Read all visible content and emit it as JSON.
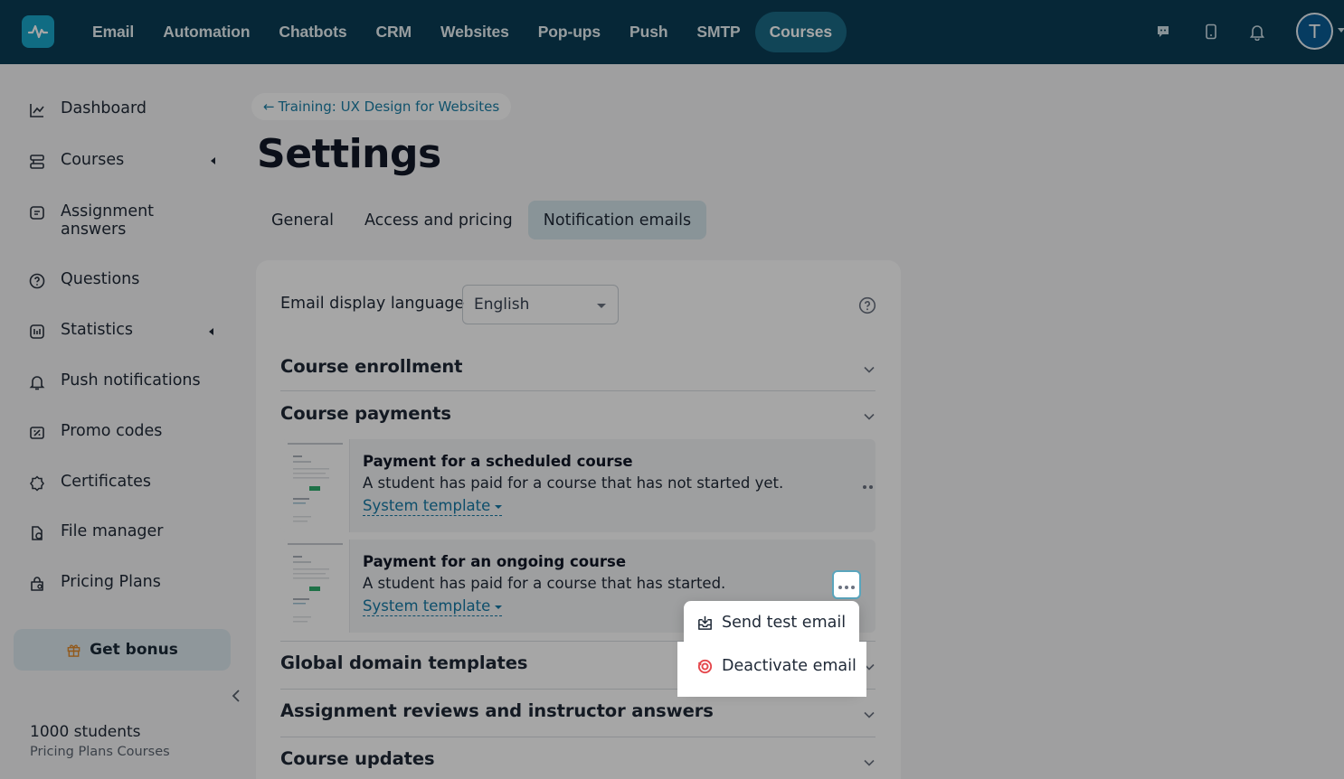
{
  "topnav": {
    "items": [
      {
        "label": "Email"
      },
      {
        "label": "Automation"
      },
      {
        "label": "Chatbots"
      },
      {
        "label": "CRM"
      },
      {
        "label": "Websites"
      },
      {
        "label": "Pop-ups"
      },
      {
        "label": "Push"
      },
      {
        "label": "SMTP"
      },
      {
        "label": "Courses",
        "active": true
      }
    ],
    "icons": [
      "chat-icon",
      "mobile-icon",
      "bell-icon"
    ],
    "avatar_initial": "T"
  },
  "sidebar": {
    "items": [
      {
        "label": "Dashboard",
        "icon": "chart-line-icon"
      },
      {
        "label": "Courses",
        "icon": "courses-icon",
        "expandable": true
      },
      {
        "label": "Assignment answers",
        "icon": "assignment-icon"
      },
      {
        "label": "Questions",
        "icon": "question-icon"
      },
      {
        "label": "Statistics",
        "icon": "statistics-icon",
        "expandable": true
      },
      {
        "label": "Push notifications",
        "icon": "bell-icon"
      },
      {
        "label": "Promo codes",
        "icon": "promo-icon"
      },
      {
        "label": "Certificates",
        "icon": "certificate-icon"
      },
      {
        "label": "File manager",
        "icon": "file-icon"
      },
      {
        "label": "Pricing Plans",
        "icon": "pricing-icon"
      }
    ],
    "bonus_label": "Get bonus",
    "plan_count": "1000 students",
    "plan_name": "Pricing Plans Courses"
  },
  "main": {
    "breadcrumb": "Training: UX Design for Websites",
    "title": "Settings",
    "tabs": [
      {
        "label": "General"
      },
      {
        "label": "Access and pricing"
      },
      {
        "label": "Notification emails",
        "active": true
      }
    ],
    "language": {
      "label": "Email display language",
      "value": "English"
    },
    "sections": [
      {
        "title": "Course enrollment"
      },
      {
        "title": "Course payments"
      },
      {
        "title": "Global domain templates"
      },
      {
        "title": "Assignment reviews and instructor answers"
      },
      {
        "title": "Course updates"
      }
    ],
    "emails": [
      {
        "title": "Payment for a scheduled course",
        "desc": "A student has paid for a course that has not started yet.",
        "template": "System template"
      },
      {
        "title": "Payment for an ongoing course",
        "desc": "A student has paid for a course that has started.",
        "template": "System template"
      }
    ]
  },
  "menu": {
    "items": [
      {
        "label": "Send test email",
        "icon": "send-test-icon"
      },
      {
        "label": "Deactivate email",
        "icon": "deactivate-icon",
        "color": "#e5484d"
      }
    ]
  },
  "colors": {
    "topbar": "#0a3d55",
    "accent": "#1479a5",
    "danger": "#e5484d"
  }
}
